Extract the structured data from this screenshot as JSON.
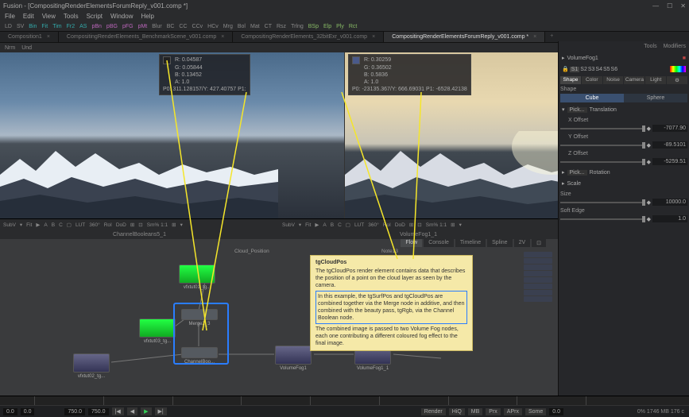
{
  "app": {
    "title": "Fusion - [CompositingRenderElementsForumReply_v001.comp *]"
  },
  "menu": [
    "File",
    "Edit",
    "View",
    "Tools",
    "Script",
    "Window",
    "Help"
  ],
  "toolbar_items": [
    "LD",
    "SV",
    "Bin",
    "Fit",
    "Tim",
    "Fr2",
    "AS",
    "pBn",
    "pBG",
    "pFG",
    "pMt",
    "Blur",
    "BC",
    "CC",
    "CCv",
    "HCv",
    "Mrg",
    "Bol",
    "Mat",
    "CT",
    "Rsz",
    "Trlng",
    "BSp",
    "Elp",
    "Ply",
    "Rct"
  ],
  "file_tabs": [
    {
      "label": "Composition1",
      "active": false
    },
    {
      "label": "CompositingRenderElements_BenchmarkScene_v001.comp",
      "active": false
    },
    {
      "label": "CompositingRenderElements_32bitExr_v001.comp",
      "active": false
    },
    {
      "label": "CompositingRenderElementsForumReply_v001.comp *",
      "active": true
    }
  ],
  "subtool": {
    "left": [
      "Nrm",
      "Und"
    ],
    "right": []
  },
  "viewer_left": {
    "pixel": {
      "r": "R: 0.04587",
      "g": "G: 0.05844",
      "b": "B: 0.13452",
      "a": "A: 1.0",
      "p": "P0: 311.128157/Y: 427.40757    P1:"
    },
    "toolbar": [
      "SubV",
      "▾",
      "Fit",
      "▶",
      "A",
      "B",
      "C",
      "▢",
      "LUT",
      "360°",
      "RoI",
      "DoD",
      "⊞",
      "⊡",
      "Sm% 1:1",
      "⊞",
      "▾"
    ],
    "label": "ChannelBooleans5_1"
  },
  "viewer_right": {
    "pixel": {
      "r": "R: 0.30259",
      "g": "G: 0.36502",
      "b": "B: 0.5836",
      "a": "A: 1.0",
      "p": "P0: -23135.367/Y: 666.69031    P1: -6528.42138"
    },
    "toolbar": [
      "SubV",
      "▾",
      "Fit",
      "▶",
      "A",
      "B",
      "C",
      "▢",
      "LUT",
      "360°",
      "RoI",
      "DoD",
      "⊞",
      "⊡",
      "Sm% 1:1",
      "⊞",
      "▾"
    ],
    "label": "VolumeFog1_1"
  },
  "flow": {
    "tabs": [
      "Flow",
      "Console",
      "Timeline",
      "Spline",
      "2V",
      "⊡"
    ],
    "title_label": "Cloud_Position",
    "note_title": "Note13",
    "note": {
      "heading": "tgCloudPos",
      "p1": "The tgCloudPos render element contains data that describes the position of a point on the cloud layer as seen by the camera.",
      "p2": "In this example, the tgSurfPos and tgCloudPos are combined together via the Merge node in additive, and then combined with the beauty pass, tgRgb, via the Channel Boolean node.",
      "p3": "The combined image is passed to two Volume Fog nodes, each one contributing a different coloured fog effect to the final image."
    },
    "nodes": {
      "n1": "vfxtut01_tg...",
      "n2": "vfxtut03_tg...",
      "n3": "vfxtut02_tg...",
      "merge": "Merge2_3",
      "cb": "ChannelBoo...",
      "vf1": "VolumeFog1",
      "vf2": "VolumeFog1_1"
    }
  },
  "inspector": {
    "top_tabs": [
      "Tools",
      "Modifiers"
    ],
    "node_name": "VolumeFog1",
    "pin": "■",
    "version_tabs": [
      "S1",
      "S2",
      "S3",
      "S4",
      "S5",
      "S6"
    ],
    "prop_tabs": [
      "Shape",
      "Color",
      "Noise",
      "Camera",
      "Light",
      "⚙"
    ],
    "section_shape": "Shape",
    "shape_btns": [
      "Cube",
      "Sphere"
    ],
    "translate_label": "Translation",
    "pick_label": "Pick...",
    "xoff_label": "X Offset",
    "xoff_val": "-7077.90",
    "yoff_label": "Y Offset",
    "yoff_val": "-89.5101",
    "zoff_label": "Z Offset",
    "zoff_val": "-5259.51",
    "rotate_label": "Rotation",
    "scale_label": "Scale",
    "size_label": "Size",
    "size_val": "10000.0",
    "softedge_label": "Soft Edge",
    "softedge_val": "1.0"
  },
  "timeline": {
    "start": "0.0",
    "in": "0.0",
    "cur": "750.0",
    "out": "750.0",
    "btns": [
      "|◀",
      "◀",
      "▶",
      "▶|"
    ],
    "right": [
      "HiQ",
      "MB",
      "Prx",
      "APrx",
      "Some"
    ],
    "end": "0.0"
  },
  "status": "0%   1746 MB    176 c"
}
